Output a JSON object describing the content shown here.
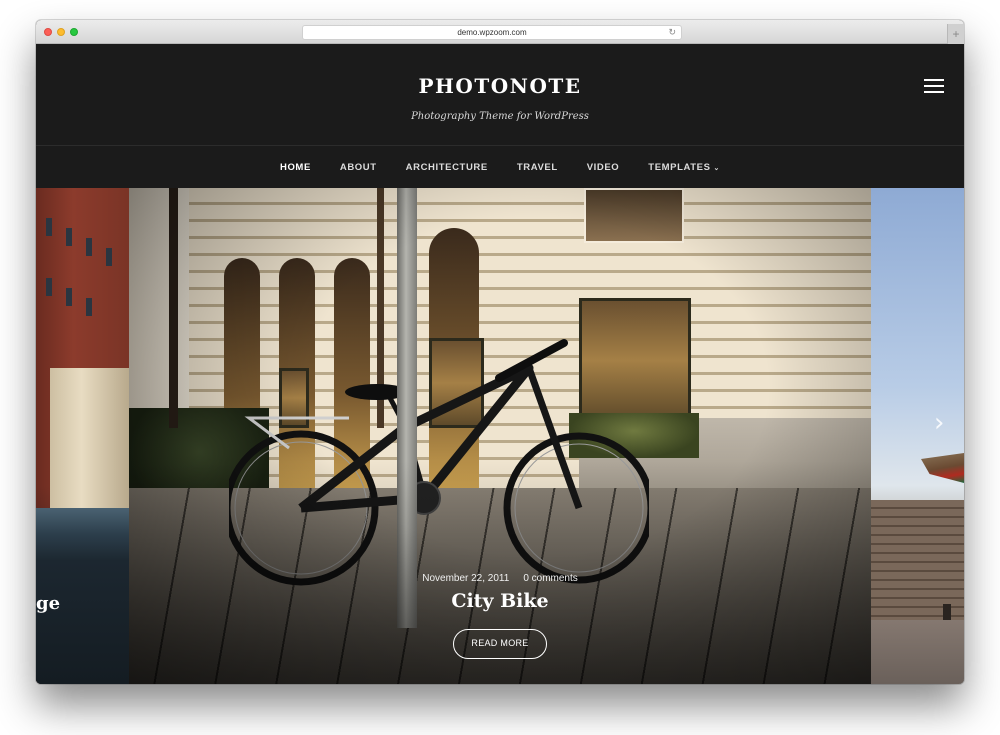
{
  "browser": {
    "url": "demo.wpzoom.com",
    "reload_icon": "↻",
    "new_tab_icon": "+"
  },
  "site": {
    "title": "PHOTONOTE",
    "tagline": "Photography Theme for WordPress",
    "menu_icon": "hamburger-icon"
  },
  "nav": {
    "items": [
      {
        "label": "HOME",
        "active": true
      },
      {
        "label": "ABOUT",
        "active": false
      },
      {
        "label": "ARCHITECTURE",
        "active": false
      },
      {
        "label": "TRAVEL",
        "active": false
      },
      {
        "label": "VIDEO",
        "active": false
      },
      {
        "label": "TEMPLATES",
        "active": false,
        "has_dropdown": true
      }
    ],
    "dropdown_caret": "⌄"
  },
  "slider": {
    "prev_slide": {
      "title_fragment": "ge"
    },
    "current_slide": {
      "date": "November 22, 2011",
      "comments": "0 comments",
      "title": "City Bike",
      "button_label": "READ MORE"
    },
    "prev_arrow": "‹",
    "next_arrow": "›"
  }
}
